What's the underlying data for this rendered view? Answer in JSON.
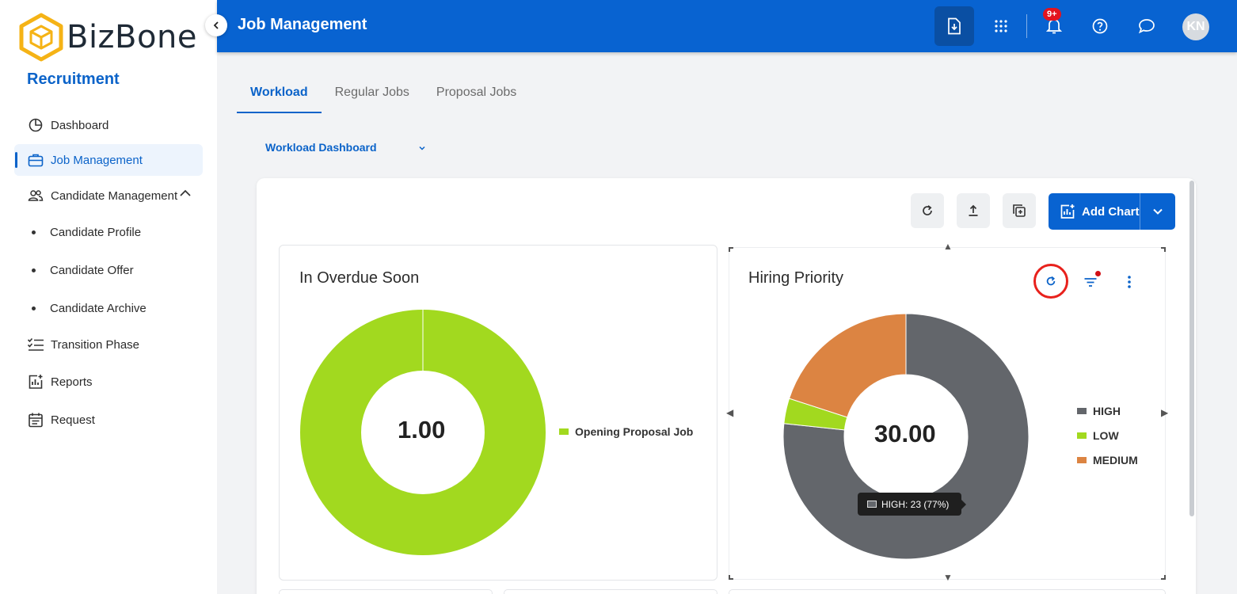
{
  "brand": {
    "name": "BizBone",
    "module": "Recruitment"
  },
  "sidebar": {
    "items": [
      {
        "label": "Dashboard"
      },
      {
        "label": "Job Management"
      },
      {
        "label": "Candidate Management"
      },
      {
        "label": "Candidate Profile"
      },
      {
        "label": "Candidate Offer"
      },
      {
        "label": "Candidate Archive"
      },
      {
        "label": "Transition Phase"
      },
      {
        "label": "Reports"
      },
      {
        "label": "Request"
      }
    ]
  },
  "header": {
    "title": "Job Management",
    "notification_badge": "9+",
    "avatar_initials": "KN"
  },
  "tabs": [
    {
      "label": "Workload"
    },
    {
      "label": "Regular Jobs"
    },
    {
      "label": "Proposal Jobs"
    }
  ],
  "dashboard_select": {
    "value": "Workload Dashboard"
  },
  "toolbar": {
    "add_chart_label": "Add Chart"
  },
  "colors": {
    "primary": "#0863d1",
    "lime": "#a2d91f",
    "gray": "#63666b",
    "orange": "#dc8442",
    "highlight_ring": "#e8211c"
  },
  "charts": {
    "overdue": {
      "title": "In Overdue Soon",
      "center_value": "1.00"
    },
    "priority": {
      "title": "Hiring Priority",
      "center_value": "30.00",
      "tooltip": "HIGH: 23 (77%)"
    }
  },
  "chart_data": [
    {
      "type": "pie",
      "title": "In Overdue Soon",
      "categories": [
        "Opening Proposal Job"
      ],
      "values": [
        1
      ],
      "colors": [
        "#a2d91f"
      ],
      "center_label": "1.00",
      "legend": "right"
    },
    {
      "type": "pie",
      "title": "Hiring Priority",
      "categories": [
        "HIGH",
        "LOW",
        "MEDIUM"
      ],
      "values": [
        23,
        1,
        6
      ],
      "colors": [
        "#63666b",
        "#a2d91f",
        "#dc8442"
      ],
      "center_label": "30.00",
      "legend": "right"
    }
  ]
}
